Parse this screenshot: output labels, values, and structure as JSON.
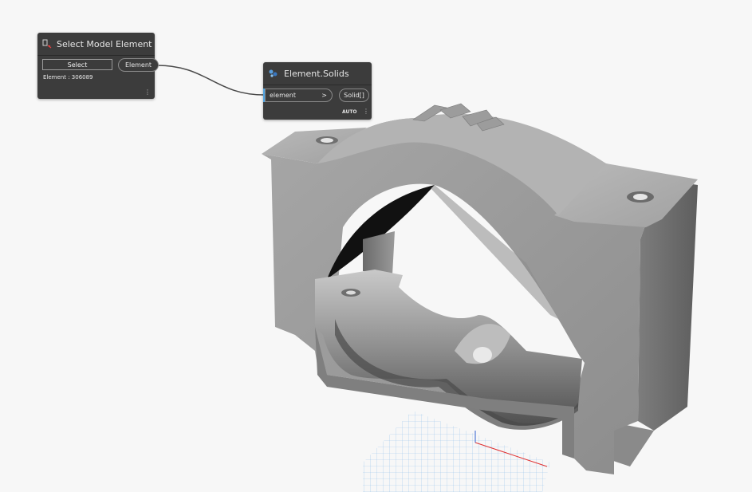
{
  "nodes": {
    "select_model_element": {
      "title": "Select Model Element",
      "button_label": "Select",
      "element_text": "Element : 306089",
      "output_port": "Element"
    },
    "element_solids": {
      "title": "Element.Solids",
      "input_port": "element",
      "input_arrow": ">",
      "output_port": "Solid[]",
      "mode_label": "AUTO"
    }
  },
  "colors": {
    "background": "#f7f7f7",
    "node_body": "#3c3c3c",
    "wire": "#4a4a4a",
    "input_accent": "#4fa3e0",
    "model_gray": "#9c9c9c",
    "grid": "#7fb6e8"
  },
  "icons": {
    "select_node_icon": "select-element-icon",
    "solids_node_icon": "solids-icon",
    "node_menu_icon": "vertical-ellipsis-icon"
  }
}
